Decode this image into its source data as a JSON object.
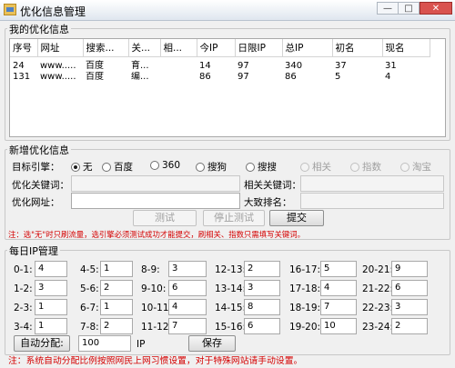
{
  "window": {
    "title": "优化信息管理",
    "minimize": "—",
    "maximize": "□",
    "close": "✕"
  },
  "my_info": {
    "label": "我的优化信息",
    "columns": [
      "序号",
      "网址",
      "搜索...",
      "关...",
      "相...",
      "今IP",
      "日限IP",
      "总IP",
      "初名",
      "现名"
    ],
    "rows": [
      [
        "24",
        "www.....",
        "百度",
        "育...",
        "",
        "14",
        "97",
        "340",
        "37",
        "31"
      ],
      [
        "131",
        "www.....",
        "百度",
        "编...",
        "",
        "86",
        "97",
        "86",
        "5",
        "4"
      ]
    ]
  },
  "add_info": {
    "label": "新增优化信息",
    "engine_label": "目标引擎：",
    "engines": [
      {
        "label": "无",
        "checked": true,
        "disabled": false
      },
      {
        "label": "百度",
        "checked": false,
        "disabled": false
      },
      {
        "label": "360",
        "checked": false,
        "disabled": false
      },
      {
        "label": "搜狗",
        "checked": false,
        "disabled": false
      },
      {
        "label": "搜搜",
        "checked": false,
        "disabled": false
      },
      {
        "label": "相关",
        "checked": false,
        "disabled": true
      },
      {
        "label": "指数",
        "checked": false,
        "disabled": true
      },
      {
        "label": "淘宝",
        "checked": false,
        "disabled": true
      }
    ],
    "keyword_label": "优化关键词：",
    "keyword_value": "",
    "related_label": "相关关键词：",
    "related_value": "",
    "url_label": "优化网址：",
    "url_value": "",
    "rank_label": "大致排名：",
    "rank_value": "",
    "test_button": "测试",
    "stop_test_button": "停止测试",
    "submit_button": "提交",
    "note": "注：选\"无\"时只刷流量，选引擎必须测试成功才能提交，刷相关、指数只需填写关键词。"
  },
  "daily_ip": {
    "label": "每日IP管理",
    "slots": [
      {
        "label": "0-1:",
        "value": "4"
      },
      {
        "label": "4-5:",
        "value": "1"
      },
      {
        "label": "8-9:",
        "value": "3"
      },
      {
        "label": "12-13:",
        "value": "2"
      },
      {
        "label": "16-17:",
        "value": "5"
      },
      {
        "label": "20-21:",
        "value": "9"
      },
      {
        "label": "1-2:",
        "value": "3"
      },
      {
        "label": "5-6:",
        "value": "2"
      },
      {
        "label": "9-10:",
        "value": "6"
      },
      {
        "label": "13-14:",
        "value": "3"
      },
      {
        "label": "17-18:",
        "value": "4"
      },
      {
        "label": "21-22:",
        "value": "6"
      },
      {
        "label": "2-3:",
        "value": "1"
      },
      {
        "label": "6-7:",
        "value": "1"
      },
      {
        "label": "10-11:",
        "value": "4"
      },
      {
        "label": "14-15:",
        "value": "8"
      },
      {
        "label": "18-19:",
        "value": "7"
      },
      {
        "label": "22-23:",
        "value": "3"
      },
      {
        "label": "3-4:",
        "value": "1"
      },
      {
        "label": "7-8:",
        "value": "2"
      },
      {
        "label": "11-12:",
        "value": "7"
      },
      {
        "label": "15-16:",
        "value": "6"
      },
      {
        "label": "19-20:",
        "value": "10"
      },
      {
        "label": "23-24:",
        "value": "2"
      }
    ],
    "auto_button": "自动分配:",
    "auto_value": "100",
    "ip_unit": "IP",
    "save_button": "保存",
    "note": "注：系统自动分配比例按照网民上网习惯设置，对于特殊网站请手动设置。"
  }
}
